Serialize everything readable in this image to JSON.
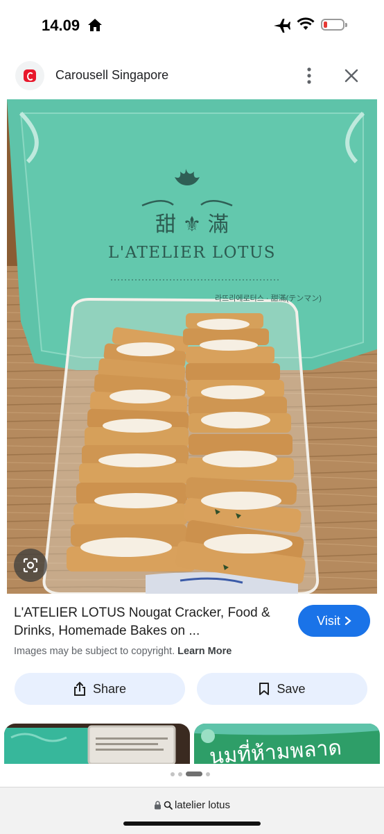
{
  "status_bar": {
    "time": "14.09"
  },
  "header": {
    "site_name": "Carousell Singapore"
  },
  "photo": {
    "box_brand_chinese": "甜 ⚜ 滿",
    "box_brand": "L'ATELIER LOTUS",
    "box_subtext": "라뜨리에로터스 · 甜滿(テンマン)"
  },
  "result": {
    "title": "L'ATELIER LOTUS Nougat Cracker, Food & Drinks, Homemade Bakes on ...",
    "visit_label": "Visit",
    "copyright_text": "Images may be subject to copyright.",
    "learn_more": "Learn More"
  },
  "actions": {
    "share_label": "Share",
    "save_label": "Save"
  },
  "related": {
    "thumb2_text": "นมที่ห้ามพลาด"
  },
  "bottom": {
    "url_text": "latelier lotus"
  },
  "colors": {
    "accent": "#1a73e8",
    "pill_bg": "#e8f0fe",
    "box_teal": "#5dc2a8"
  }
}
